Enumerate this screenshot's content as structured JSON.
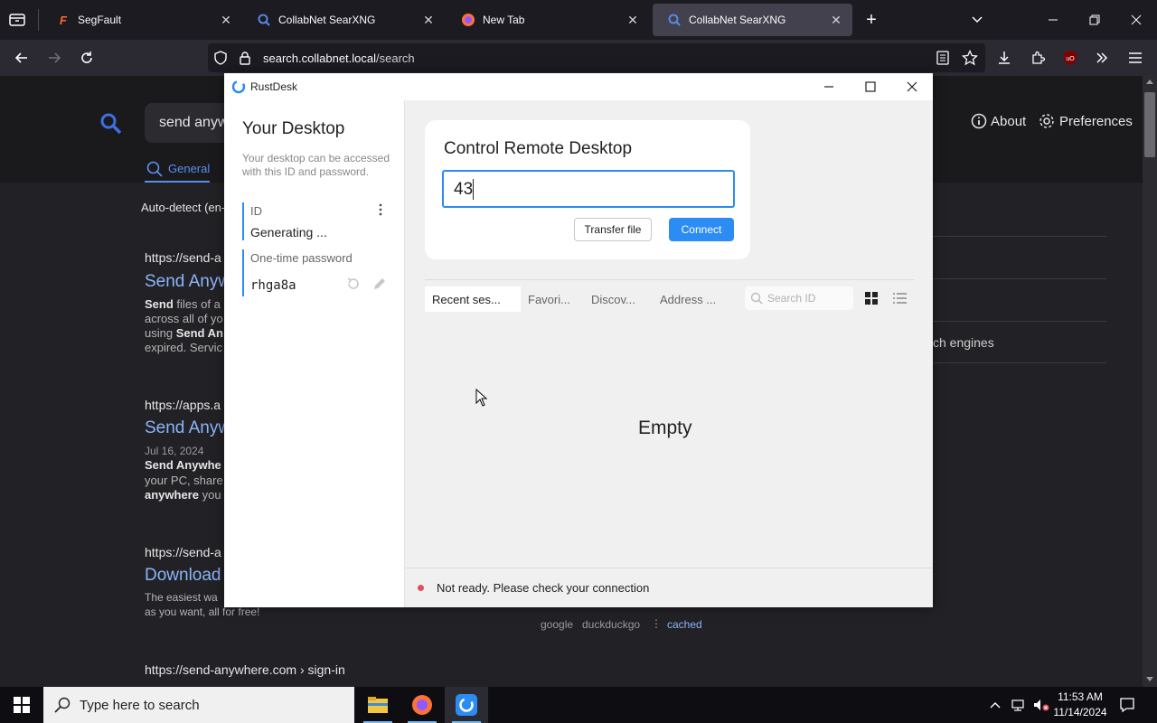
{
  "browser": {
    "tabs": [
      {
        "label": "SegFault",
        "icon": "segfault-icon"
      },
      {
        "label": "CollabNet SearXNG",
        "icon": "searxng-icon"
      },
      {
        "label": "New Tab",
        "icon": "firefox-icon"
      },
      {
        "label": "CollabNet SearXNG",
        "icon": "searxng-icon",
        "active": true
      }
    ],
    "url_domain": "search.collabnet.local",
    "url_path": "/search"
  },
  "page": {
    "query": "send anyw",
    "tab_general": "General",
    "autodetect": "Auto-detect (en-",
    "about": "About",
    "preferences": "Preferences",
    "right_snippet": "ch engines",
    "results": [
      {
        "url": "https://send-a",
        "title": "Send Anyw",
        "snippet1_b": "Send",
        "snippet1": " files of a",
        "snippet2": "across all of yo",
        "snippet3_pre": "using ",
        "snippet3_b": "Send An",
        "snippet4": "expired. Servic"
      },
      {
        "url": "https://apps.a",
        "title": "Send Anyw",
        "date": "Jul 16, 2024",
        "snippet1_b": "Send Anywhe",
        "snippet2": "your PC, share",
        "snippet3_b": "anywhere",
        "snippet3": " you"
      },
      {
        "url": "https://send-a",
        "title": "Download",
        "snippet1": "The easiest wa",
        "snippet2": "as you want, all for free!"
      },
      {
        "url": "https://send-anywhere.com  › sign-in"
      }
    ],
    "engines": {
      "google": "google",
      "duckduckgo": "duckduckgo",
      "cached": "cached"
    }
  },
  "rustdesk": {
    "window_title": "RustDesk",
    "your_desktop": "Your Desktop",
    "desc": "Your desktop can be accessed with this ID and password.",
    "id_label": "ID",
    "id_value": "Generating ...",
    "otp_label": "One-time password",
    "otp_value": "rhga8a",
    "control_title": "Control Remote Desktop",
    "id_input_value": "43",
    "transfer_file": "Transfer file",
    "connect": "Connect",
    "tabs": [
      "Recent ses...",
      "Favori...",
      "Discov...",
      "Address ..."
    ],
    "search_id_placeholder": "Search ID",
    "empty": "Empty",
    "status": "Not ready. Please check your connection",
    "status_color": "#e04f5f",
    "accent": "#2c8cf4"
  },
  "taskbar": {
    "search_placeholder": "Type here to search",
    "time": "11:53 AM",
    "date": "11/14/2024"
  }
}
